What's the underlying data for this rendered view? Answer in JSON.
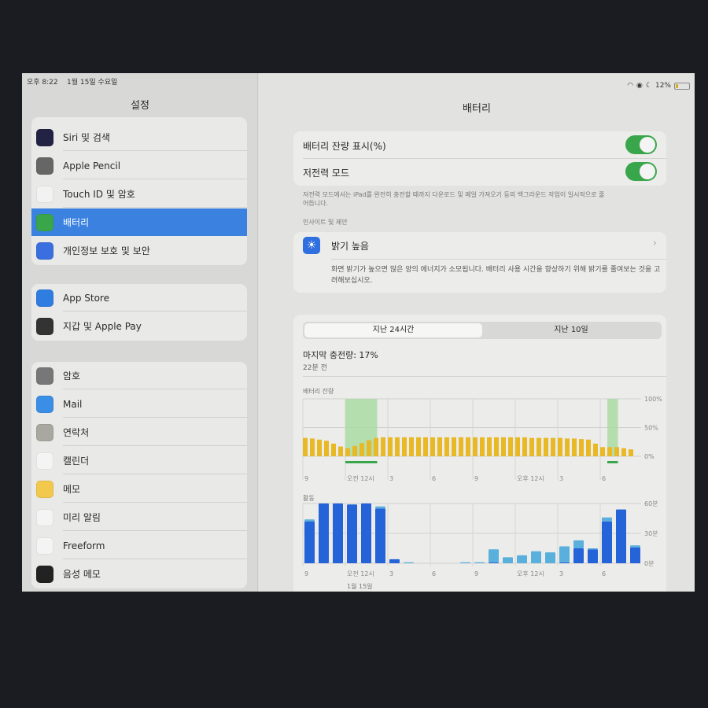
{
  "status_bar": {
    "time": "오후 8:22",
    "date": "1월 15일 수요일",
    "battery_percent": "12%",
    "icons": [
      "wifi-icon",
      "focus-icon",
      "moon-icon",
      "battery-icon"
    ]
  },
  "sidebar": {
    "title": "설정",
    "groups": [
      [
        {
          "label": "Siri 및 검색",
          "icon": "siri-icon",
          "color": "#222244"
        },
        {
          "label": "Apple Pencil",
          "icon": "pencil-icon",
          "color": "#666666"
        },
        {
          "label": "Touch ID 및 암호",
          "icon": "fingerprint-icon",
          "color": "#f2f2f2"
        },
        {
          "label": "배터리",
          "icon": "battery-icon",
          "color": "#3aa64c",
          "selected": true
        },
        {
          "label": "개인정보 보호 및 보안",
          "icon": "hand-icon",
          "color": "#3b6fe0"
        }
      ],
      [
        {
          "label": "App Store",
          "icon": "app-store-icon",
          "color": "#2f7de1"
        },
        {
          "label": "지갑 및 Apple Pay",
          "icon": "wallet-icon",
          "color": "#333333"
        }
      ],
      [
        {
          "label": "암호",
          "icon": "key-icon",
          "color": "#777777"
        },
        {
          "label": "Mail",
          "icon": "mail-icon",
          "color": "#3a8ee6"
        },
        {
          "label": "연락처",
          "icon": "contacts-icon",
          "color": "#a8a8a0"
        },
        {
          "label": "캘린더",
          "icon": "calendar-icon",
          "color": "#f4f4f4"
        },
        {
          "label": "메모",
          "icon": "notes-icon",
          "color": "#f2c94c"
        },
        {
          "label": "미리 알림",
          "icon": "reminders-icon",
          "color": "#f4f4f4"
        },
        {
          "label": "Freeform",
          "icon": "freeform-icon",
          "color": "#f4f4f4"
        },
        {
          "label": "음성 메모",
          "icon": "voice-memo-icon",
          "color": "#222222"
        }
      ]
    ]
  },
  "detail": {
    "title": "배터리",
    "toggles": [
      {
        "label": "배터리 잔량 표시(%)",
        "on": true
      },
      {
        "label": "저전력 모드",
        "on": true
      }
    ],
    "low_power_note": "저전력 모드에서는 iPad를 완전히 충전할 때까지 다운로드 및 메일 가져오기 등의 백그라운드 작업이 일시적으로 줄어듭니다.",
    "insights_header": "인사이트 및 제안",
    "insight": {
      "title": "밝기 높음",
      "icon": "sun-icon",
      "body": "화면 밝기가 높으면 많은 양의 에너지가 소모됩니다. 배터리 사용 시간을 향상하기 위해 밝기를 줄여보는 것을 고려해보십시오."
    },
    "segments": [
      {
        "label": "지난 24시간",
        "selected": true
      },
      {
        "label": "지난 10일",
        "selected": false
      }
    ],
    "last_charge": "마지막 충전량: 17%",
    "last_charge_ago": "22분 전",
    "date_label": "1월 15일"
  },
  "chart_data": [
    {
      "type": "bar",
      "title": "배터리 잔량",
      "x_start": "오후 9:00",
      "interval": "30분",
      "x_ticks": [
        "9",
        "오전 12시",
        "3",
        "6",
        "9",
        "오후 12시",
        "3",
        "6"
      ],
      "y_ticks": [
        "100%",
        "50%",
        "0%"
      ],
      "ylim": [
        0,
        100
      ],
      "values": [
        32,
        31,
        29,
        27,
        22,
        17,
        14,
        18,
        23,
        28,
        32,
        33,
        33,
        33,
        33,
        33,
        33,
        33,
        33,
        33,
        33,
        33,
        33,
        33,
        33,
        33,
        33,
        33,
        33,
        33,
        33,
        33,
        32,
        32,
        32,
        32,
        32,
        31,
        31,
        30,
        29,
        22,
        16,
        16,
        16,
        14,
        12
      ],
      "charging": [
        [
          "오전 12:00",
          "오전 2:15"
        ],
        [
          "오후 6:30",
          "오후 7:15"
        ]
      ],
      "colors": {
        "bar": "#e8b825",
        "charging": "#a8dba0",
        "charge_icon": "#3aa64c"
      }
    },
    {
      "type": "bar",
      "stacked": true,
      "title": "활동",
      "x_start": "오후 9시",
      "interval": "1시간",
      "x_ticks": [
        "9",
        "오전 12시",
        "3",
        "6",
        "9",
        "오후 12시",
        "3",
        "6"
      ],
      "y_ticks": [
        "60분",
        "30분",
        "0분"
      ],
      "ylim": [
        0,
        60
      ],
      "series": [
        {
          "key": "screen_on",
          "color": "#2463d8",
          "values": [
            42,
            60,
            60,
            59,
            60,
            55,
            4,
            0,
            0,
            0,
            0,
            0,
            0,
            1,
            0,
            0,
            0,
            0,
            1,
            15,
            14,
            42,
            54,
            16
          ]
        },
        {
          "key": "screen_off",
          "color": "#5ab0dc",
          "values": [
            2,
            0,
            0,
            0,
            0,
            2,
            0,
            1,
            0,
            0,
            0,
            1,
            1,
            13,
            6,
            8,
            12,
            11,
            16,
            8,
            1,
            4,
            0,
            2
          ]
        }
      ]
    }
  ]
}
